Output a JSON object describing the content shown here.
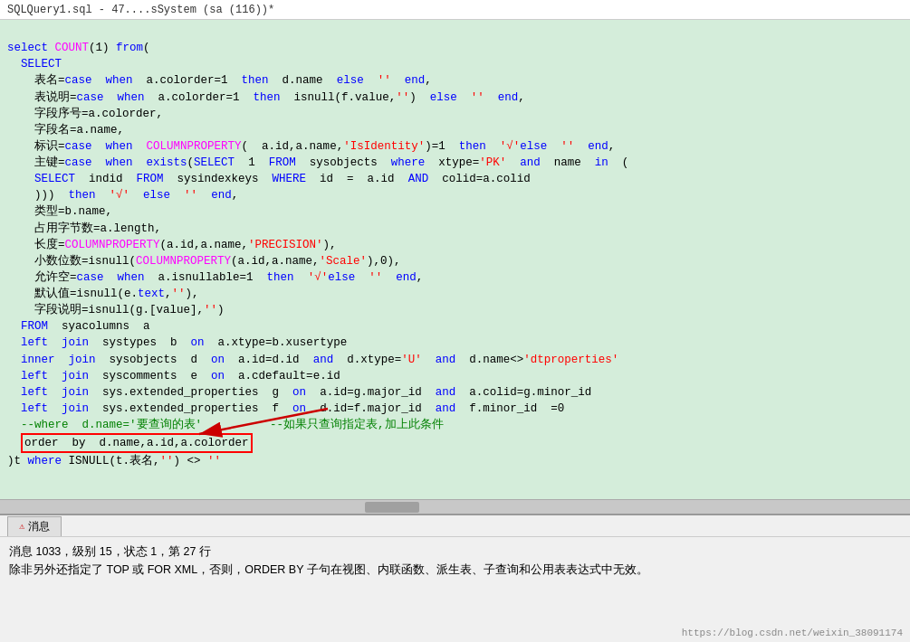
{
  "titleBar": {
    "text": "SQLQuery1.sql - 47....sSystem (sa (116))*"
  },
  "editor": {
    "lines": []
  },
  "messagesTab": {
    "label": "消息"
  },
  "messagesContent": {
    "line1": "消息 1033，级别 15，状态 1，第 27 行",
    "line2": "除非另外还指定了 TOP 或 FOR XML，否则，ORDER BY 子句在视图、内联函数、派生表、子查询和公用表表达式中无效。"
  },
  "watermark": {
    "text": "https://blog.csdn.net/weixin_38091174"
  },
  "annotation": {
    "text": "--如果只查询指定表,加上此条件"
  }
}
